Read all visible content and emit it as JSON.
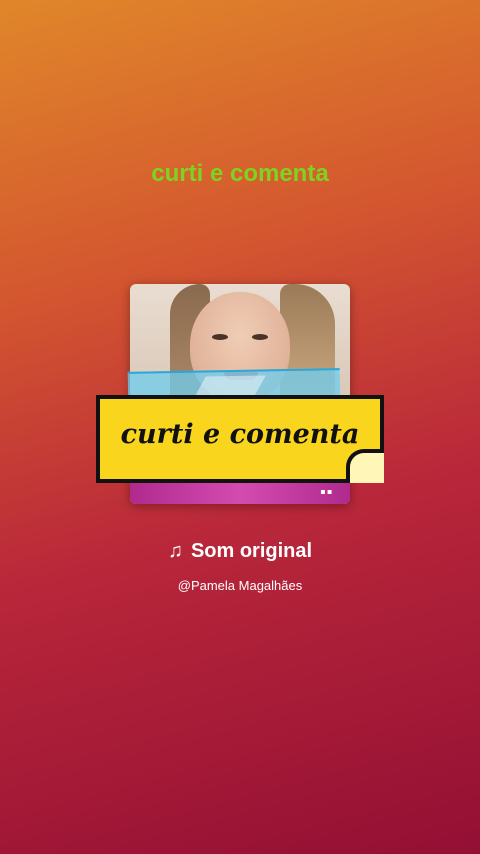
{
  "caption": "curti e comenta",
  "sticker": {
    "text": "curti e comenta"
  },
  "sound": {
    "icon": "music-note-icon",
    "note_glyph": "♫",
    "label": "Som original"
  },
  "user": {
    "handle": "@Pamela Magalhães"
  },
  "colors": {
    "caption": "#7ed321",
    "sticker": "#f9d51e",
    "tape": "#6ecdf0"
  }
}
